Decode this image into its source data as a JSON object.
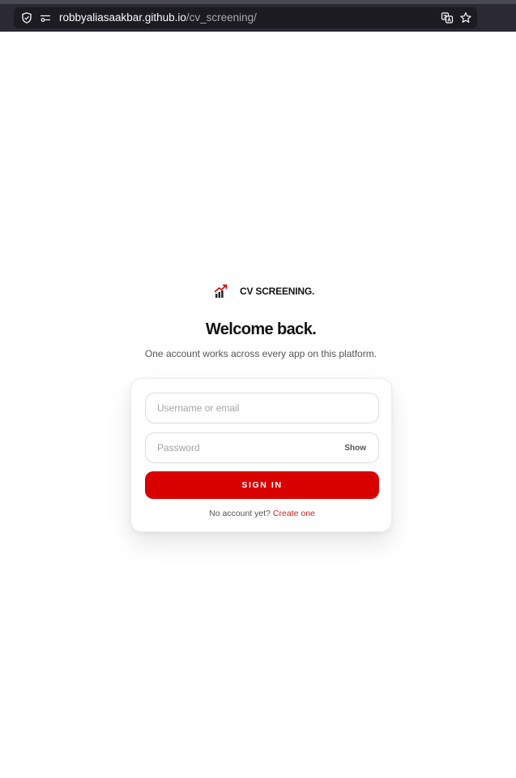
{
  "browser": {
    "url_host": "robbyaliasaakbar.github.io",
    "url_path": "/cv_screening/"
  },
  "brand": {
    "name": "CV SCREENING.",
    "logo_icon": "bar-chart-arrow-icon"
  },
  "heading": {
    "title": "Welcome back.",
    "subtitle": "One account works across every app on this platform."
  },
  "form": {
    "username_placeholder": "Username or email",
    "username_value": "",
    "password_placeholder": "Password",
    "password_value": "",
    "show_label": "Show",
    "submit_label": "SIGN IN",
    "signup_prompt": "No account yet?",
    "signup_link": "Create one"
  },
  "colors": {
    "accent": "#d90000",
    "link": "#d71f1f",
    "toolbar": "#2b2a33"
  }
}
